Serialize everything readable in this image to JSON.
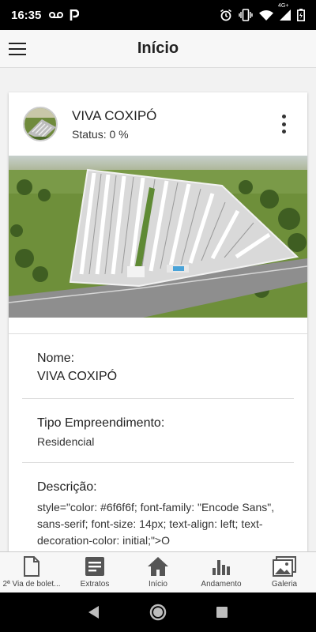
{
  "status_bar": {
    "time": "16:35",
    "left_icons": [
      "voicemail-icon",
      "parking-icon"
    ],
    "right_icons": [
      "alarm-icon",
      "vibrate-icon",
      "wifi-icon",
      "signal-4g-icon",
      "battery-icon"
    ],
    "network_label": "4G+"
  },
  "header": {
    "title": "Início",
    "menu_icon": "hamburger-menu-icon"
  },
  "project": {
    "name": "VIVA COXIPÓ",
    "status": "Status: 0 %",
    "more_icon": "more-vertical-icon"
  },
  "details": {
    "name_label": "Nome:",
    "name_value": "VIVA COXIPÓ",
    "type_label": "Tipo Empreendimento:",
    "type_value": "Residencial",
    "desc_label": "Descrição:",
    "desc_value": "style=\"color: #6f6f6f; font-family: \"Encode Sans\", sans-serif; font-size: 14px; text-align: left; text-decoration-color: initial;\">O"
  },
  "tabs": [
    {
      "label": "2ª Via de bolet...",
      "icon": "document-icon"
    },
    {
      "label": "Extratos",
      "icon": "statement-icon"
    },
    {
      "label": "Início",
      "icon": "home-icon"
    },
    {
      "label": "Andamento",
      "icon": "bar-chart-icon"
    },
    {
      "label": "Galeria",
      "icon": "gallery-icon"
    }
  ],
  "colors": {
    "icon_gray": "#555555",
    "header_bg": "#f7f7f7",
    "card_bg": "#ffffff"
  }
}
